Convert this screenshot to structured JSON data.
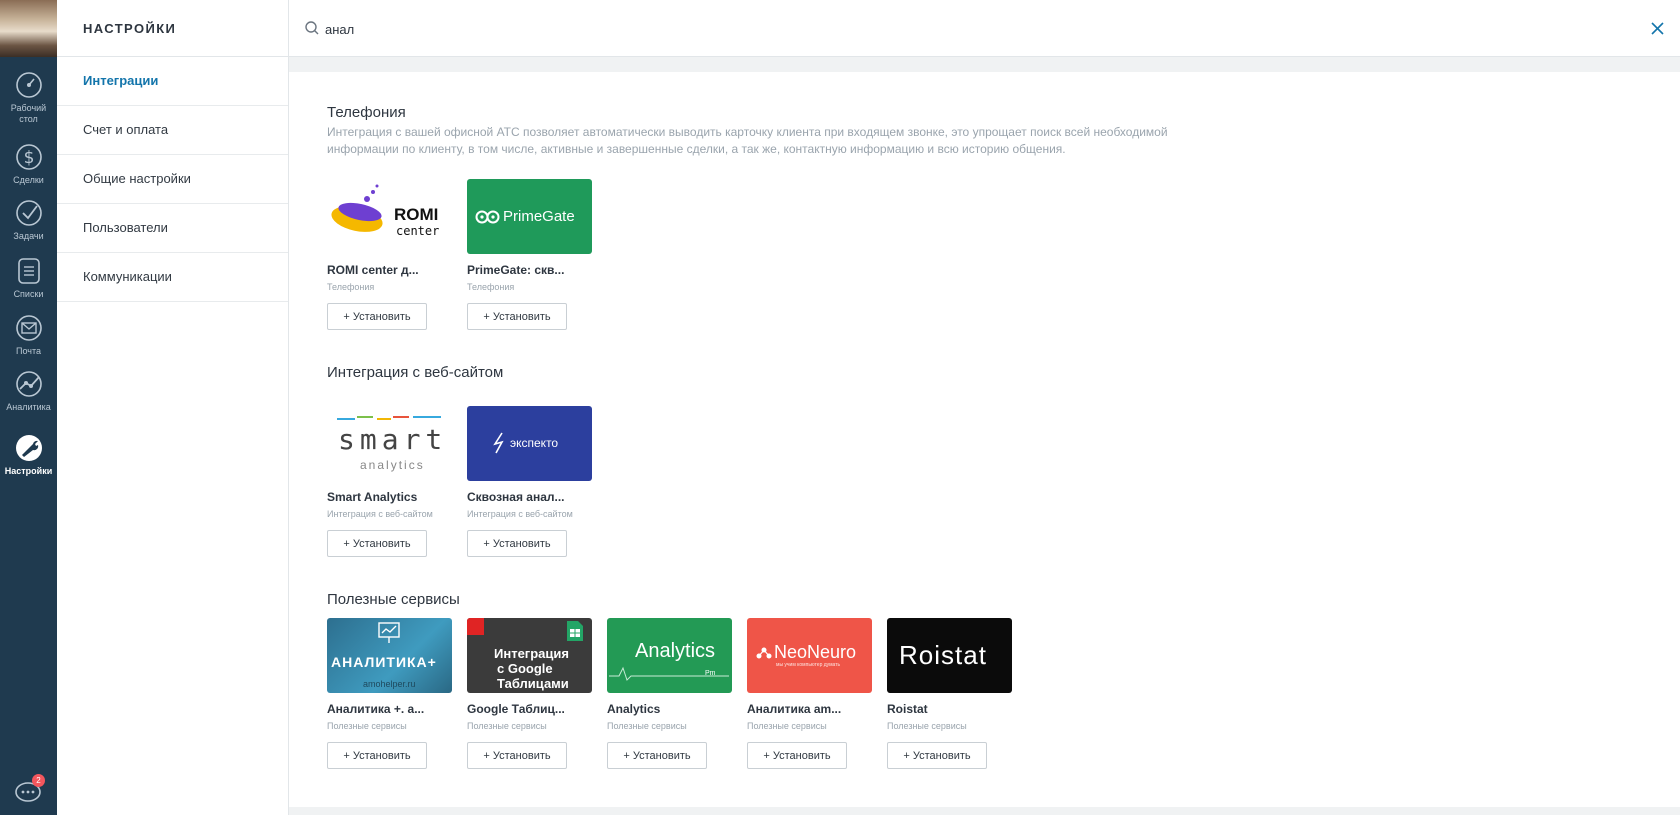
{
  "nav": {
    "items": [
      {
        "label_line1": "Рабочий",
        "label_line2": "стол",
        "icon": "dashboard-icon"
      },
      {
        "label": "Сделки",
        "icon": "dollar-icon"
      },
      {
        "label": "Задачи",
        "icon": "check-icon"
      },
      {
        "label": "Списки",
        "icon": "list-icon"
      },
      {
        "label": "Почта",
        "icon": "mail-icon"
      },
      {
        "label": "Аналитика",
        "icon": "analytics-icon"
      },
      {
        "label": "Настройки",
        "icon": "wrench-icon"
      }
    ],
    "chat_badge": "2"
  },
  "settings": {
    "title": "НАСТРОЙКИ",
    "items": [
      "Интеграции",
      "Счет и оплата",
      "Общие настройки",
      "Пользователи",
      "Коммуникации"
    ],
    "active_index": 0
  },
  "search": {
    "value": "анал"
  },
  "install_label": "+ Установить",
  "sections": [
    {
      "title": "Телефония",
      "description": "Интеграция с вашей офисной АТС позволяет автоматически выводить карточку клиента при входящем звонке, это упрощает поиск всей необходимой информации по клиенту, в том числе, активные и завершенные сделки, а так же, контактную информацию и всю историю общения.",
      "cards": [
        {
          "name": "ROMI center д...",
          "category": "Телефония",
          "logo_line1": "ROMI",
          "logo_line2": "center"
        },
        {
          "name": "PrimeGate: скв...",
          "category": "Телефония",
          "logo_text": "PrimeGate"
        }
      ]
    },
    {
      "title": "Интеграция с веб-сайтом",
      "cards": [
        {
          "name": "Smart Analytics",
          "category": "Интеграция с веб-сайтом",
          "logo_line1": "smart",
          "logo_line2": "analytics"
        },
        {
          "name": "Сквозная анал...",
          "category": "Интеграция с веб-сайтом",
          "logo_text": "экспекто"
        }
      ]
    },
    {
      "title": "Полезные сервисы",
      "cards": [
        {
          "name": "Аналитика +. а...",
          "category": "Полезные сервисы",
          "logo_text": "АНАЛИТИКА+",
          "logo_sub": "amohelper.ru"
        },
        {
          "name": "Google Таблиц...",
          "category": "Полезные сервисы",
          "logo_line1": "Интеграция",
          "logo_line2": "с Google",
          "logo_line3": "Таблицами"
        },
        {
          "name": "Analytics",
          "category": "Полезные сервисы",
          "logo_text": "Analytics",
          "logo_sub": "Pm"
        },
        {
          "name": "Аналитика am...",
          "category": "Полезные сервисы",
          "logo_text": "NeoNeuro",
          "logo_sub": "мы учим компьютер думать"
        },
        {
          "name": "Roistat",
          "category": "Полезные сервисы",
          "logo_text": "Roistat"
        }
      ]
    }
  ],
  "colors": {
    "nav_bg": "#1f3a4f",
    "accent": "#1375ab",
    "primegate": "#1f9a5a",
    "expecto": "#2c3f9e",
    "analytics_pm": "#239a55",
    "neoneuro": "#ef5548",
    "roistat": "#0b0b0b"
  }
}
